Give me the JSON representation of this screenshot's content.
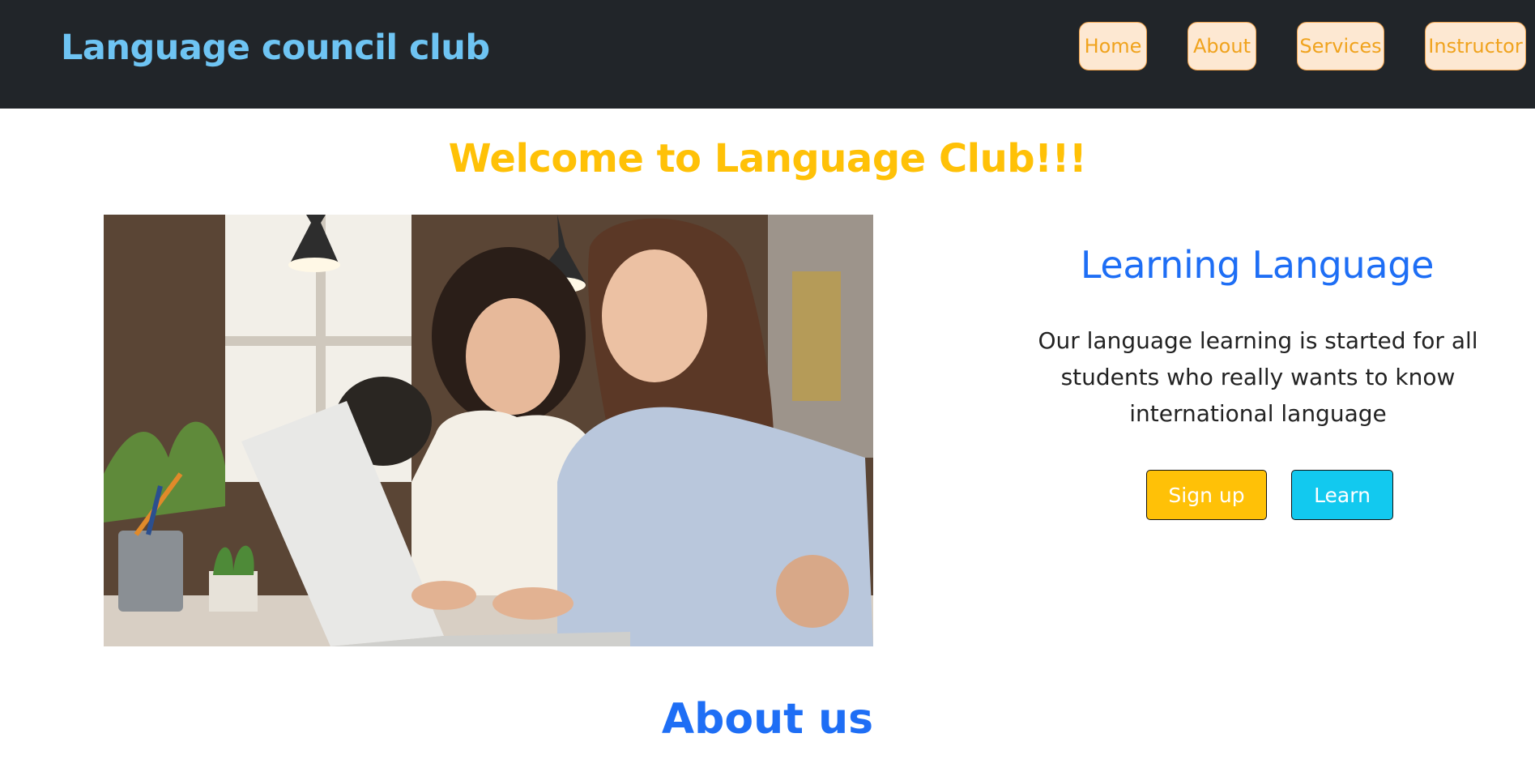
{
  "header": {
    "brand": "Language council club",
    "nav": [
      {
        "label": "Home"
      },
      {
        "label": "About"
      },
      {
        "label": "Services"
      },
      {
        "label": "Instructor"
      }
    ]
  },
  "hero": {
    "welcome": "Welcome to Language Club!!!",
    "photo_description_icon": "photo-two-students-with-laptop",
    "title": "Learning Language",
    "text": "Our language learning is started for all students who really wants to know international language",
    "buttons": {
      "signup": "Sign up",
      "learn": "Learn"
    }
  },
  "about": {
    "title": "About us"
  },
  "colors": {
    "navbar_bg": "#212529",
    "brand": "#6ec4f3",
    "nav_button_bg": "#fde8d2",
    "nav_button_text": "#f0a31e",
    "welcome": "#ffc107",
    "title_blue": "#1e6ef5",
    "signup_bg": "#ffc107",
    "learn_bg": "#12c9ef"
  }
}
